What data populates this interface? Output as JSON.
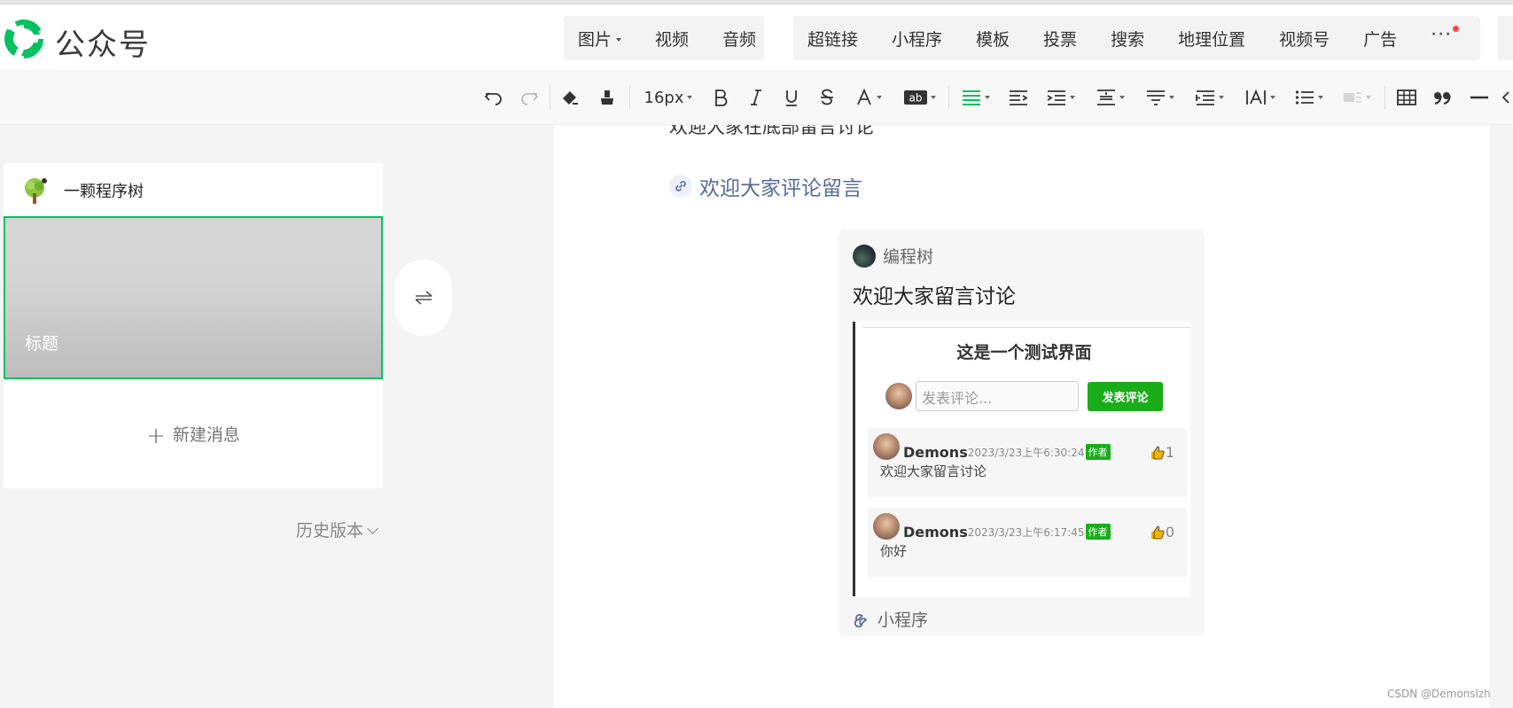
{
  "header": {
    "app_name": "公众号",
    "media_menu": [
      {
        "label": "图片",
        "dropdown": true
      },
      {
        "label": "视频",
        "dropdown": false
      },
      {
        "label": "音频",
        "dropdown": false
      }
    ],
    "insert_menu": [
      "超链接",
      "小程序",
      "模板",
      "投票",
      "搜索",
      "地理位置",
      "视频号",
      "广告"
    ],
    "more_label": "···"
  },
  "toolbar": {
    "font_size": "16px",
    "icons": [
      "undo-icon",
      "redo-icon",
      "format-paint-icon",
      "clear-format-icon",
      "bold-icon",
      "italic-icon",
      "underline-icon",
      "strikethrough-icon",
      "font-color-icon",
      "highlight-icon",
      "align-icon",
      "indent-icon",
      "line-spacing-icon",
      "letter-spacing-icon",
      "list-icon",
      "table-icon",
      "quote-icon",
      "divider-icon"
    ],
    "colors": {
      "active": "#07c160"
    }
  },
  "sidebar": {
    "account_name": "一颗程序树",
    "cover_title": "标题",
    "new_message": "新建消息",
    "history": "历史版本"
  },
  "editor": {
    "cut_text": "欢迎大家在底部留言讨论",
    "link_text": "欢迎大家评论留言",
    "mini_card": {
      "account": "编程树",
      "title": "欢迎大家留言讨论",
      "footer": "小程序",
      "screenshot": {
        "heading": "这是一个测试界面",
        "input_placeholder": "发表评论...",
        "submit": "发表评论",
        "comments": [
          {
            "user": "Demons",
            "time": "2023/3/23上午6:30:24",
            "tag": "作者",
            "likes": "1",
            "text": "欢迎大家留言讨论"
          },
          {
            "user": "Demons",
            "time": "2023/3/23上午6:17:45",
            "tag": "作者",
            "likes": "0",
            "text": "你好"
          }
        ]
      }
    }
  },
  "watermark": "CSDN @Demonslzh"
}
